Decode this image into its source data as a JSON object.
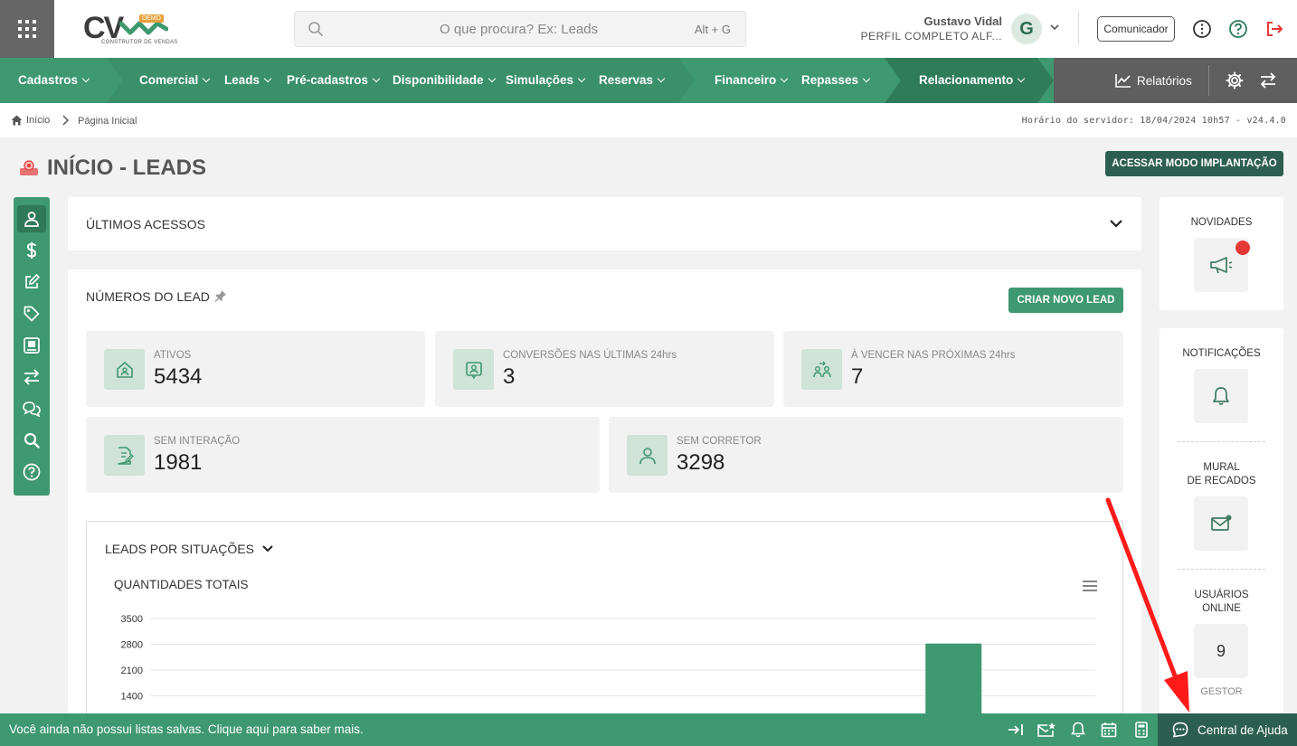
{
  "header": {
    "logo_text": "CV",
    "logo_badge": "DEMO",
    "logo_sub": "CONSTRUTOR DE VENDAS",
    "search_placeholder": "O que procura? Ex: Leads",
    "search_shortcut": "Alt + G",
    "user_name": "Gustavo Vidal",
    "user_profile": "PERFIL COMPLETO ALF...",
    "avatar_letter": "G",
    "communicator_label": "Comunicador"
  },
  "nav": {
    "items": [
      {
        "label": "Cadastros"
      },
      {
        "label": "Comercial"
      },
      {
        "label": "Leads"
      },
      {
        "label": "Pré-cadastros"
      },
      {
        "label": "Disponibilidade"
      },
      {
        "label": "Simulações"
      },
      {
        "label": "Reservas"
      },
      {
        "label": "Financeiro"
      },
      {
        "label": "Repasses"
      },
      {
        "label": "Relacionamento"
      }
    ],
    "reports_label": "Relatórios"
  },
  "breadcrumb": {
    "home": "Início",
    "page": "Página Inicial",
    "server_time": "Horário do servidor: 18/04/2024 10h57 - v24.4.0"
  },
  "page": {
    "title": "INÍCIO - LEADS",
    "implant_button": "ACESSAR MODO IMPLANTAÇÃO"
  },
  "last_access": {
    "title": "ÚLTIMOS ACESSOS"
  },
  "lead_numbers": {
    "title": "NÚMEROS DO LEAD",
    "new_lead_button": "CRIAR NOVO LEAD",
    "stats": [
      {
        "label": "ATIVOS",
        "value": "5434",
        "icon": "house-icon"
      },
      {
        "label": "CONVERSÕES NAS ÚLTIMAS 24hrs",
        "value": "3",
        "icon": "user-badge-icon"
      },
      {
        "label": "À VENCER NAS PRÓXIMAS 24hrs",
        "value": "7",
        "icon": "users-swap-icon"
      },
      {
        "label": "SEM INTERAÇÃO",
        "value": "1981",
        "icon": "document-edit-icon"
      },
      {
        "label": "SEM CORRETOR",
        "value": "3298",
        "icon": "person-icon"
      }
    ]
  },
  "chart_section": {
    "title": "LEADS POR SITUAÇÕES",
    "subtitle": "QUANTIDADES TOTAIS"
  },
  "chart_data": {
    "type": "bar",
    "title": "QUANTIDADES TOTAIS",
    "yticks": [
      "3500",
      "2800",
      "2100",
      "1400"
    ],
    "ylim": [
      0,
      3500
    ],
    "grid": true,
    "visible_values": [
      {
        "slot": 7,
        "value": 80
      },
      {
        "slot": 8,
        "value": 2820
      }
    ],
    "slots": 10
  },
  "sidebar_right": {
    "news_label": "NOVIDADES",
    "notifications_label": "NOTIFICAÇÕES",
    "wall_label_1": "MURAL",
    "wall_label_2": "DE RECADOS",
    "online_label_1": "USUÁRIOS",
    "online_label_2": "ONLINE",
    "online_count": "9",
    "manager_label": "GESTOR"
  },
  "footer": {
    "message": "Você ainda não possui listas salvas. Clique aqui para saber mais.",
    "help_label": "Central de Ajuda"
  },
  "colors": {
    "primary": "#3e9870",
    "dark": "#2c5f4f",
    "alert": "#e53935",
    "annotation_arrow": "#ff1a1a"
  }
}
